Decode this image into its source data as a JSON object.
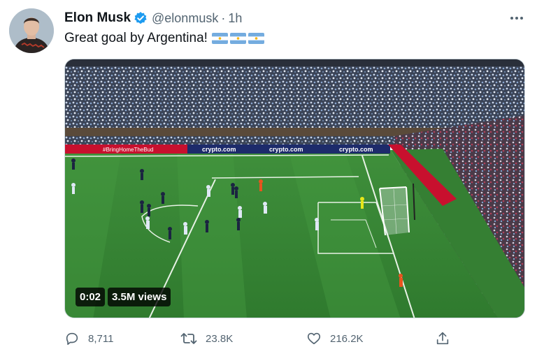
{
  "author": {
    "display_name": "Elon Musk",
    "handle": "@elonmusk",
    "separator": "·",
    "time": "1h"
  },
  "tweet": {
    "text": "Great goal by Argentina!",
    "flag_emoji_count": 3
  },
  "media": {
    "duration": "0:02",
    "views": "3.5M views",
    "ad_boards": [
      "#BringHomeTheBud",
      "crypto.com",
      "crypto.com",
      "crypto.com"
    ]
  },
  "actions": {
    "replies": "8,711",
    "retweets": "23.8K",
    "likes": "216.2K"
  },
  "colors": {
    "accent": "#1d9bf0",
    "text_primary": "#0f1419",
    "text_secondary": "#536471",
    "pitch": "#3d8c3a"
  },
  "icons": [
    "verified-badge-icon",
    "more-icon",
    "reply-icon",
    "retweet-icon",
    "like-icon",
    "share-icon",
    "argentina-flag-icon"
  ]
}
